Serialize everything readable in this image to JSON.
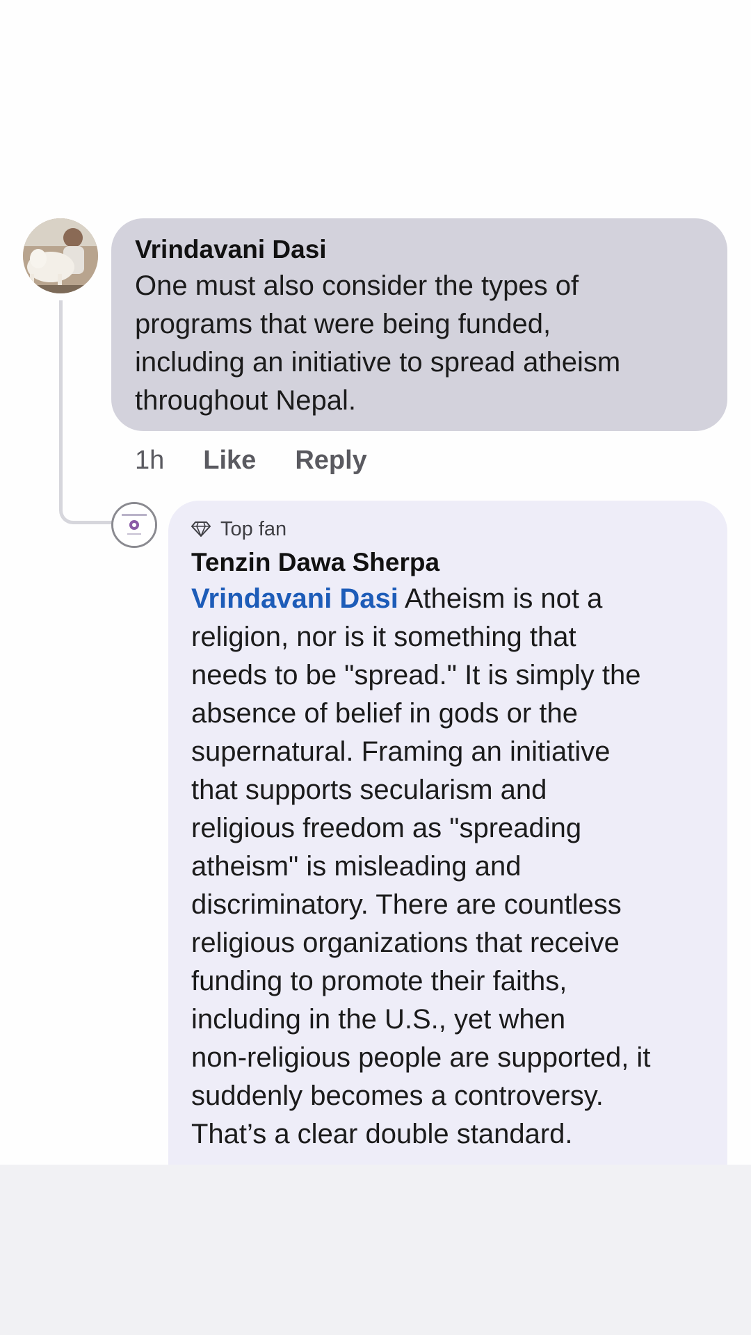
{
  "comment": {
    "author": "Vrindavani Dasi",
    "lines": [
      "One must also consider the types of",
      "programs that were being funded,",
      "including an initiative to spread atheism",
      "throughout Nepal."
    ],
    "time": "1h",
    "like_label": "Like",
    "reply_label": "Reply"
  },
  "reply": {
    "badge": "Top fan",
    "author": "Tenzin Dawa Sherpa",
    "mention": "Vrindavani Dasi",
    "first_line_rest": " Atheism is not a",
    "lines": [
      "religion, nor is it something that",
      "needs to be \"spread.\" It is simply the",
      "absence of belief in gods or the",
      "supernatural. Framing an initiative",
      "that supports secularism and",
      "religious freedom as \"spreading",
      "atheism\" is misleading and",
      "discriminatory. There are countless",
      "religious organizations that receive",
      "funding to promote their faiths,",
      "including in the U.S., yet when",
      "non-religious people are supported, it",
      "suddenly becomes a controversy.",
      "That’s a clear double standard."
    ]
  },
  "colors": {
    "comment_bubble": "#d3d2dc",
    "reply_bubble": "#eeedf8",
    "mention": "#1d5cb8",
    "bottom_area": "#f1f1f4"
  },
  "icons": {
    "top_fan": "diamond-icon",
    "avatar_commenter": "user-avatar-photo",
    "avatar_replier": "user-avatar-logo"
  }
}
